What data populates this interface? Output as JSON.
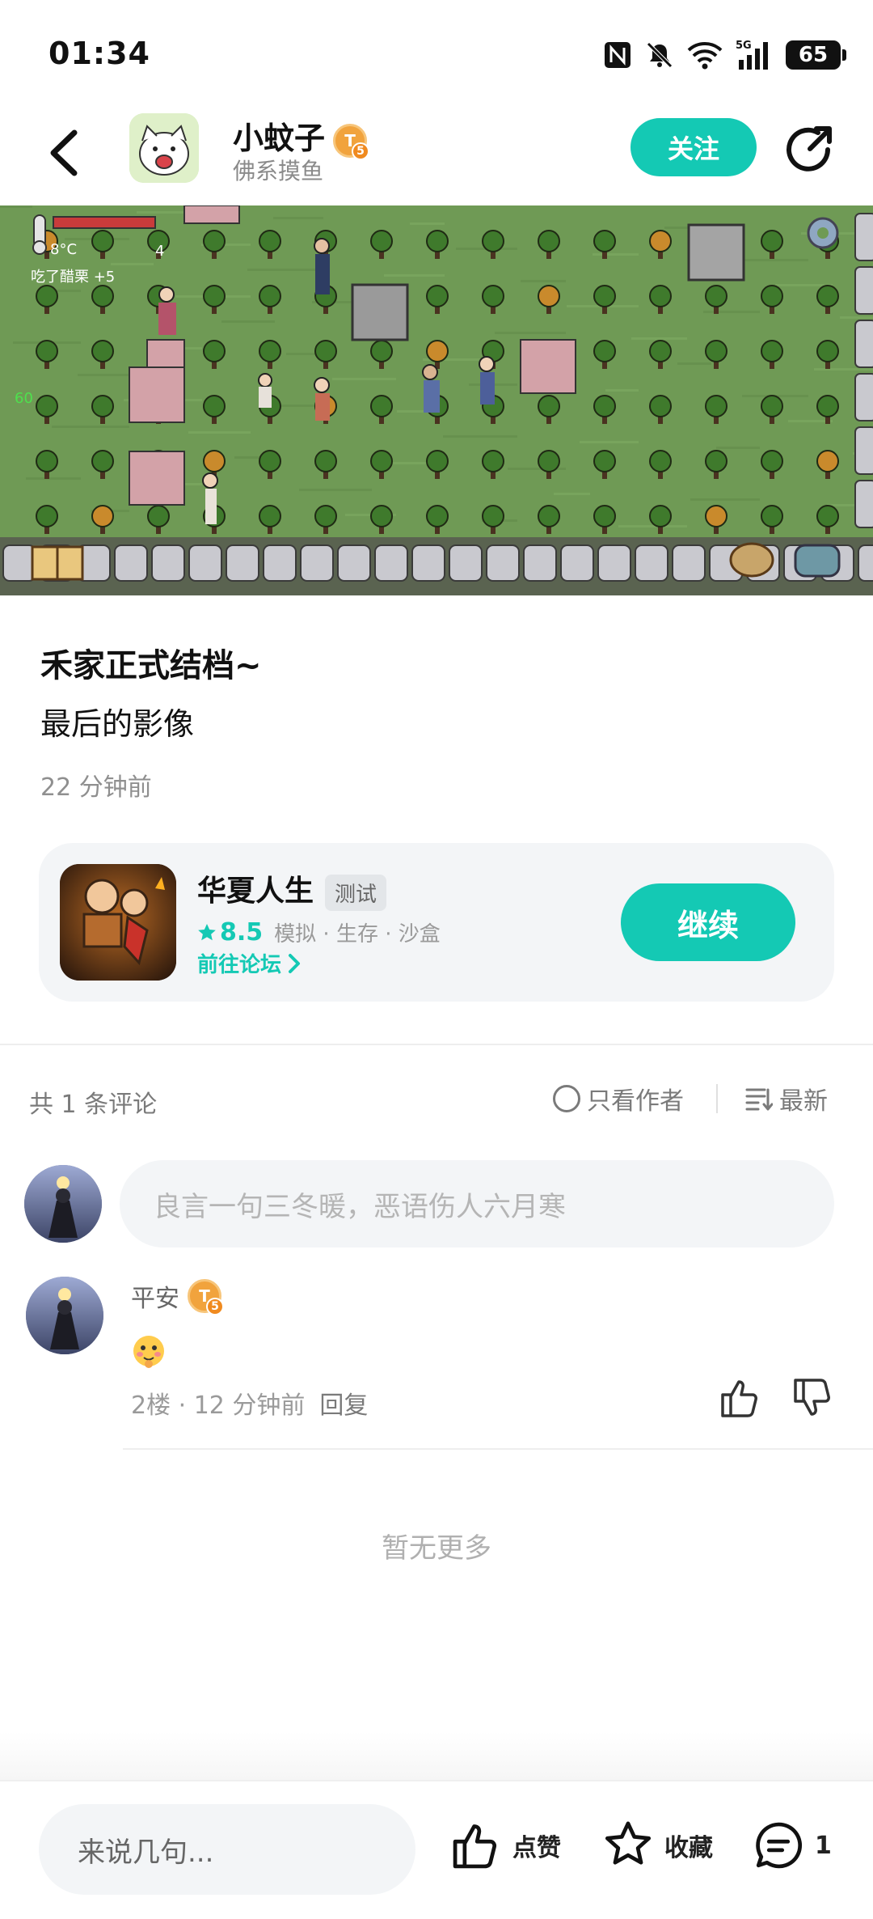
{
  "status_bar": {
    "time": "01:34",
    "battery": "65"
  },
  "header": {
    "author_name": "小蚊子",
    "author_subtitle": "佛系摸鱼",
    "level": "5",
    "follow_label": "关注"
  },
  "game_screenshot": {
    "temperature": "8°C",
    "status_text": "吃了醋栗 +5",
    "counter": "4",
    "side_number": "60"
  },
  "post": {
    "title": "禾家正式结档~",
    "body": "最后的影像",
    "time": "22 分钟前"
  },
  "game_card": {
    "name": "华夏人生",
    "tag": "测试",
    "rating": "8.5",
    "genres": "模拟 · 生存 · 沙盒",
    "forum_link": "前往论坛",
    "continue_label": "继续"
  },
  "comments_section": {
    "count_label": "共 1 条评论",
    "author_only_label": "只看作者",
    "sort_label": "最新",
    "input_placeholder": "良言一句三冬暖，恶语伤人六月寒",
    "comments": [
      {
        "name": "平安",
        "level": "5",
        "meta": "2楼 · 12 分钟前",
        "reply_label": "回复"
      }
    ],
    "no_more": "暂无更多"
  },
  "bottom_bar": {
    "input_placeholder": "来说几句...",
    "like_label": "点赞",
    "favorite_label": "收藏",
    "comment_count": "1"
  },
  "colors": {
    "accent": "#14c9b4",
    "badge": "#f1a33d"
  }
}
